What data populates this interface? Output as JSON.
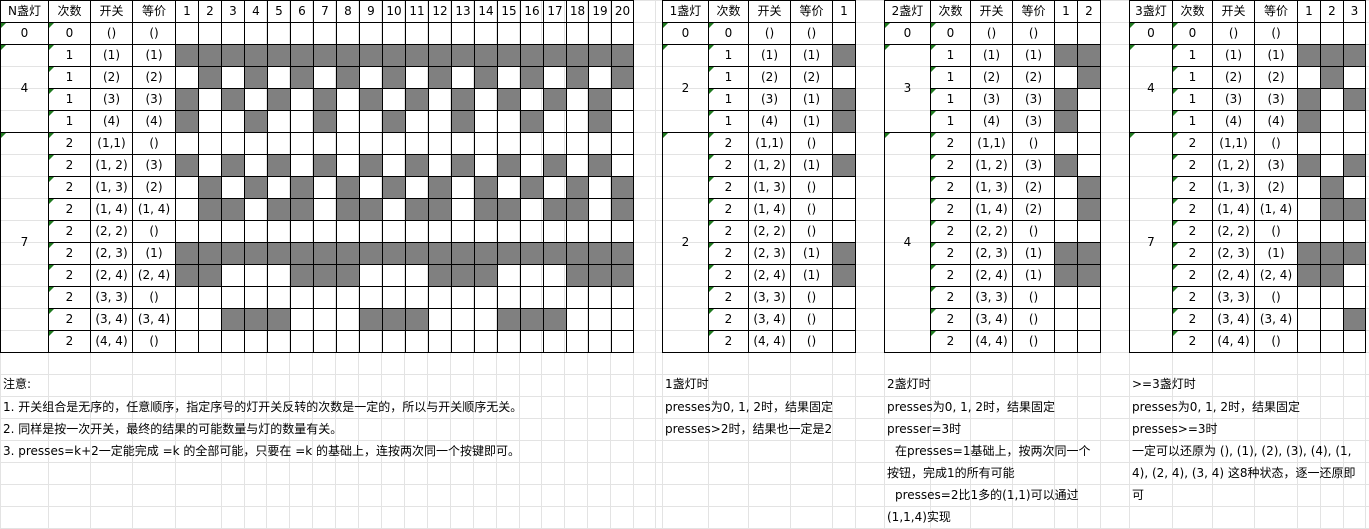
{
  "colors": {
    "shade": "#808080",
    "grid": "#e3e3e3",
    "border": "#000000",
    "marker": "#1f7a1f"
  },
  "tables": [
    {
      "id": "t1",
      "headers": [
        "N盏灯",
        "次数",
        "开关",
        "等价"
      ],
      "light_numbers": [
        "1",
        "2",
        "3",
        "4",
        "5",
        "6",
        "7",
        "8",
        "9",
        "10",
        "11",
        "12",
        "13",
        "14",
        "15",
        "16",
        "17",
        "18",
        "19",
        "20"
      ],
      "groups": [
        {
          "n": "0",
          "rows": [
            0,
            0
          ]
        },
        {
          "n": "4",
          "rows": [
            1,
            4
          ]
        },
        {
          "n": "7",
          "rows": [
            5,
            14
          ]
        }
      ],
      "rows": [
        {
          "count": "0",
          "switch": "()",
          "equiv": "()",
          "lights": "00000000000000000000"
        },
        {
          "count": "1",
          "switch": "(1)",
          "equiv": "(1)",
          "lights": "11111111111111111111"
        },
        {
          "count": "1",
          "switch": "(2)",
          "equiv": "(2)",
          "lights": "01010101010101010101"
        },
        {
          "count": "1",
          "switch": "(3)",
          "equiv": "(3)",
          "lights": "10101010101010101010"
        },
        {
          "count": "1",
          "switch": "(4)",
          "equiv": "(4)",
          "lights": "10010010010010010010"
        },
        {
          "count": "2",
          "switch": "(1,1)",
          "equiv": "()",
          "lights": "00000000000000000000"
        },
        {
          "count": "2",
          "switch": "(1, 2)",
          "equiv": "(3)",
          "lights": "10101010101010101010"
        },
        {
          "count": "2",
          "switch": "(1, 3)",
          "equiv": "(2)",
          "lights": "01010101010101010101"
        },
        {
          "count": "2",
          "switch": "(1, 4)",
          "equiv": "(1, 4)",
          "lights": "01101101101101101101"
        },
        {
          "count": "2",
          "switch": "(2, 2)",
          "equiv": "()",
          "lights": "00000000000000000000"
        },
        {
          "count": "2",
          "switch": "(2, 3)",
          "equiv": "(1)",
          "lights": "11111111111111111111"
        },
        {
          "count": "2",
          "switch": "(2, 4)",
          "equiv": "(2, 4)",
          "lights": "11000111000111000111"
        },
        {
          "count": "2",
          "switch": "(3, 3)",
          "equiv": "()",
          "lights": "00000000000000000000"
        },
        {
          "count": "2",
          "switch": "(3, 4)",
          "equiv": "(3, 4)",
          "lights": "00111000111000111000"
        },
        {
          "count": "2",
          "switch": "(4, 4)",
          "equiv": "()",
          "lights": "00000000000000000000"
        }
      ]
    },
    {
      "id": "t2",
      "headers": [
        "1盏灯",
        "次数",
        "开关",
        "等价"
      ],
      "light_numbers": [
        "1"
      ],
      "groups": [
        {
          "n": "0",
          "rows": [
            0,
            0
          ]
        },
        {
          "n": "2",
          "rows": [
            1,
            4
          ]
        },
        {
          "n": "2",
          "rows": [
            5,
            14
          ]
        }
      ],
      "rows": [
        {
          "count": "0",
          "switch": "()",
          "equiv": "()",
          "lights": "0"
        },
        {
          "count": "1",
          "switch": "(1)",
          "equiv": "(1)",
          "lights": "1"
        },
        {
          "count": "1",
          "switch": "(2)",
          "equiv": "(2)",
          "lights": "0"
        },
        {
          "count": "1",
          "switch": "(3)",
          "equiv": "(1)",
          "lights": "1"
        },
        {
          "count": "1",
          "switch": "(4)",
          "equiv": "(1)",
          "lights": "1"
        },
        {
          "count": "2",
          "switch": "(1,1)",
          "equiv": "()",
          "lights": "0"
        },
        {
          "count": "2",
          "switch": "(1, 2)",
          "equiv": "(1)",
          "lights": "1"
        },
        {
          "count": "2",
          "switch": "(1, 3)",
          "equiv": "()",
          "lights": "0"
        },
        {
          "count": "2",
          "switch": "(1, 4)",
          "equiv": "()",
          "lights": "0"
        },
        {
          "count": "2",
          "switch": "(2, 2)",
          "equiv": "()",
          "lights": "0"
        },
        {
          "count": "2",
          "switch": "(2, 3)",
          "equiv": "(1)",
          "lights": "1"
        },
        {
          "count": "2",
          "switch": "(2, 4)",
          "equiv": "(1)",
          "lights": "1"
        },
        {
          "count": "2",
          "switch": "(3, 3)",
          "equiv": "()",
          "lights": "0"
        },
        {
          "count": "2",
          "switch": "(3, 4)",
          "equiv": "()",
          "lights": "0"
        },
        {
          "count": "2",
          "switch": "(4, 4)",
          "equiv": "()",
          "lights": "0"
        }
      ]
    },
    {
      "id": "t3",
      "headers": [
        "2盏灯",
        "次数",
        "开关",
        "等价"
      ],
      "light_numbers": [
        "1",
        "2"
      ],
      "groups": [
        {
          "n": "0",
          "rows": [
            0,
            0
          ]
        },
        {
          "n": "3",
          "rows": [
            1,
            4
          ]
        },
        {
          "n": "4",
          "rows": [
            5,
            14
          ]
        }
      ],
      "rows": [
        {
          "count": "0",
          "switch": "()",
          "equiv": "()",
          "lights": "00"
        },
        {
          "count": "1",
          "switch": "(1)",
          "equiv": "(1)",
          "lights": "11"
        },
        {
          "count": "1",
          "switch": "(2)",
          "equiv": "(2)",
          "lights": "01"
        },
        {
          "count": "1",
          "switch": "(3)",
          "equiv": "(3)",
          "lights": "10"
        },
        {
          "count": "1",
          "switch": "(4)",
          "equiv": "(3)",
          "lights": "10"
        },
        {
          "count": "2",
          "switch": "(1,1)",
          "equiv": "()",
          "lights": "00"
        },
        {
          "count": "2",
          "switch": "(1, 2)",
          "equiv": "(3)",
          "lights": "10"
        },
        {
          "count": "2",
          "switch": "(1, 3)",
          "equiv": "(2)",
          "lights": "01"
        },
        {
          "count": "2",
          "switch": "(1, 4)",
          "equiv": "(2)",
          "lights": "01"
        },
        {
          "count": "2",
          "switch": "(2, 2)",
          "equiv": "()",
          "lights": "00"
        },
        {
          "count": "2",
          "switch": "(2, 3)",
          "equiv": "(1)",
          "lights": "11"
        },
        {
          "count": "2",
          "switch": "(2, 4)",
          "equiv": "(1)",
          "lights": "11"
        },
        {
          "count": "2",
          "switch": "(3, 3)",
          "equiv": "()",
          "lights": "00"
        },
        {
          "count": "2",
          "switch": "(3, 4)",
          "equiv": "()",
          "lights": "00"
        },
        {
          "count": "2",
          "switch": "(4, 4)",
          "equiv": "()",
          "lights": "00"
        }
      ]
    },
    {
      "id": "t4",
      "headers": [
        "3盏灯",
        "次数",
        "开关",
        "等价"
      ],
      "light_numbers": [
        "1",
        "2",
        "3"
      ],
      "groups": [
        {
          "n": "0",
          "rows": [
            0,
            0
          ]
        },
        {
          "n": "4",
          "rows": [
            1,
            4
          ]
        },
        {
          "n": "7",
          "rows": [
            5,
            14
          ]
        }
      ],
      "rows": [
        {
          "count": "0",
          "switch": "()",
          "equiv": "()",
          "lights": "000"
        },
        {
          "count": "1",
          "switch": "(1)",
          "equiv": "(1)",
          "lights": "111"
        },
        {
          "count": "1",
          "switch": "(2)",
          "equiv": "(2)",
          "lights": "010"
        },
        {
          "count": "1",
          "switch": "(3)",
          "equiv": "(3)",
          "lights": "101"
        },
        {
          "count": "1",
          "switch": "(4)",
          "equiv": "(4)",
          "lights": "100"
        },
        {
          "count": "2",
          "switch": "(1,1)",
          "equiv": "()",
          "lights": "000"
        },
        {
          "count": "2",
          "switch": "(1, 2)",
          "equiv": "(3)",
          "lights": "101"
        },
        {
          "count": "2",
          "switch": "(1, 3)",
          "equiv": "(2)",
          "lights": "010"
        },
        {
          "count": "2",
          "switch": "(1, 4)",
          "equiv": "(1, 4)",
          "lights": "011"
        },
        {
          "count": "2",
          "switch": "(2, 2)",
          "equiv": "()",
          "lights": "000"
        },
        {
          "count": "2",
          "switch": "(2, 3)",
          "equiv": "(1)",
          "lights": "111"
        },
        {
          "count": "2",
          "switch": "(2, 4)",
          "equiv": "(2, 4)",
          "lights": "110"
        },
        {
          "count": "2",
          "switch": "(3, 3)",
          "equiv": "()",
          "lights": "000"
        },
        {
          "count": "2",
          "switch": "(3, 4)",
          "equiv": "(3, 4)",
          "lights": "001"
        },
        {
          "count": "2",
          "switch": "(4, 4)",
          "equiv": "()",
          "lights": "000"
        }
      ]
    }
  ],
  "notes": {
    "n1": {
      "title": "注意:",
      "lines": [
        "1. 开关组合是无序的，任意顺序，指定序号的灯开关反转的次数是一定的，所以与开关顺序无关。",
        "2. 同样是按一次开关，最终的结果的可能数量与灯的数量有关。",
        "3. presses=k+2一定能完成 =k 的全部可能，只要在 =k 的基础上，连按两次同一个按键即可。"
      ]
    },
    "n2": {
      "title": "1盏灯时",
      "lines": [
        "presses为0, 1, 2时，结果固定",
        "presses>2时，结果也一定是2"
      ]
    },
    "n3": {
      "title": "2盏灯时",
      "lines": [
        "presses为0, 1, 2时，结果固定",
        "presser=3时"
      ],
      "para1": "在presses=1基础上，按两次同一个按钮，完成1的所有可能",
      "para2": "presses=2比1多的(1,1)可以通过(1,1,4)实现"
    },
    "n4": {
      "title": ">=3盏灯时",
      "lines": [
        "presses为0, 1, 2时，结果固定",
        "presses>=3时"
      ],
      "para1": "一定可以还原为 (), (1), (2), (3), (4), (1, 4), (2, 4), (3, 4) 这8种状态，逐一还原即可"
    }
  }
}
